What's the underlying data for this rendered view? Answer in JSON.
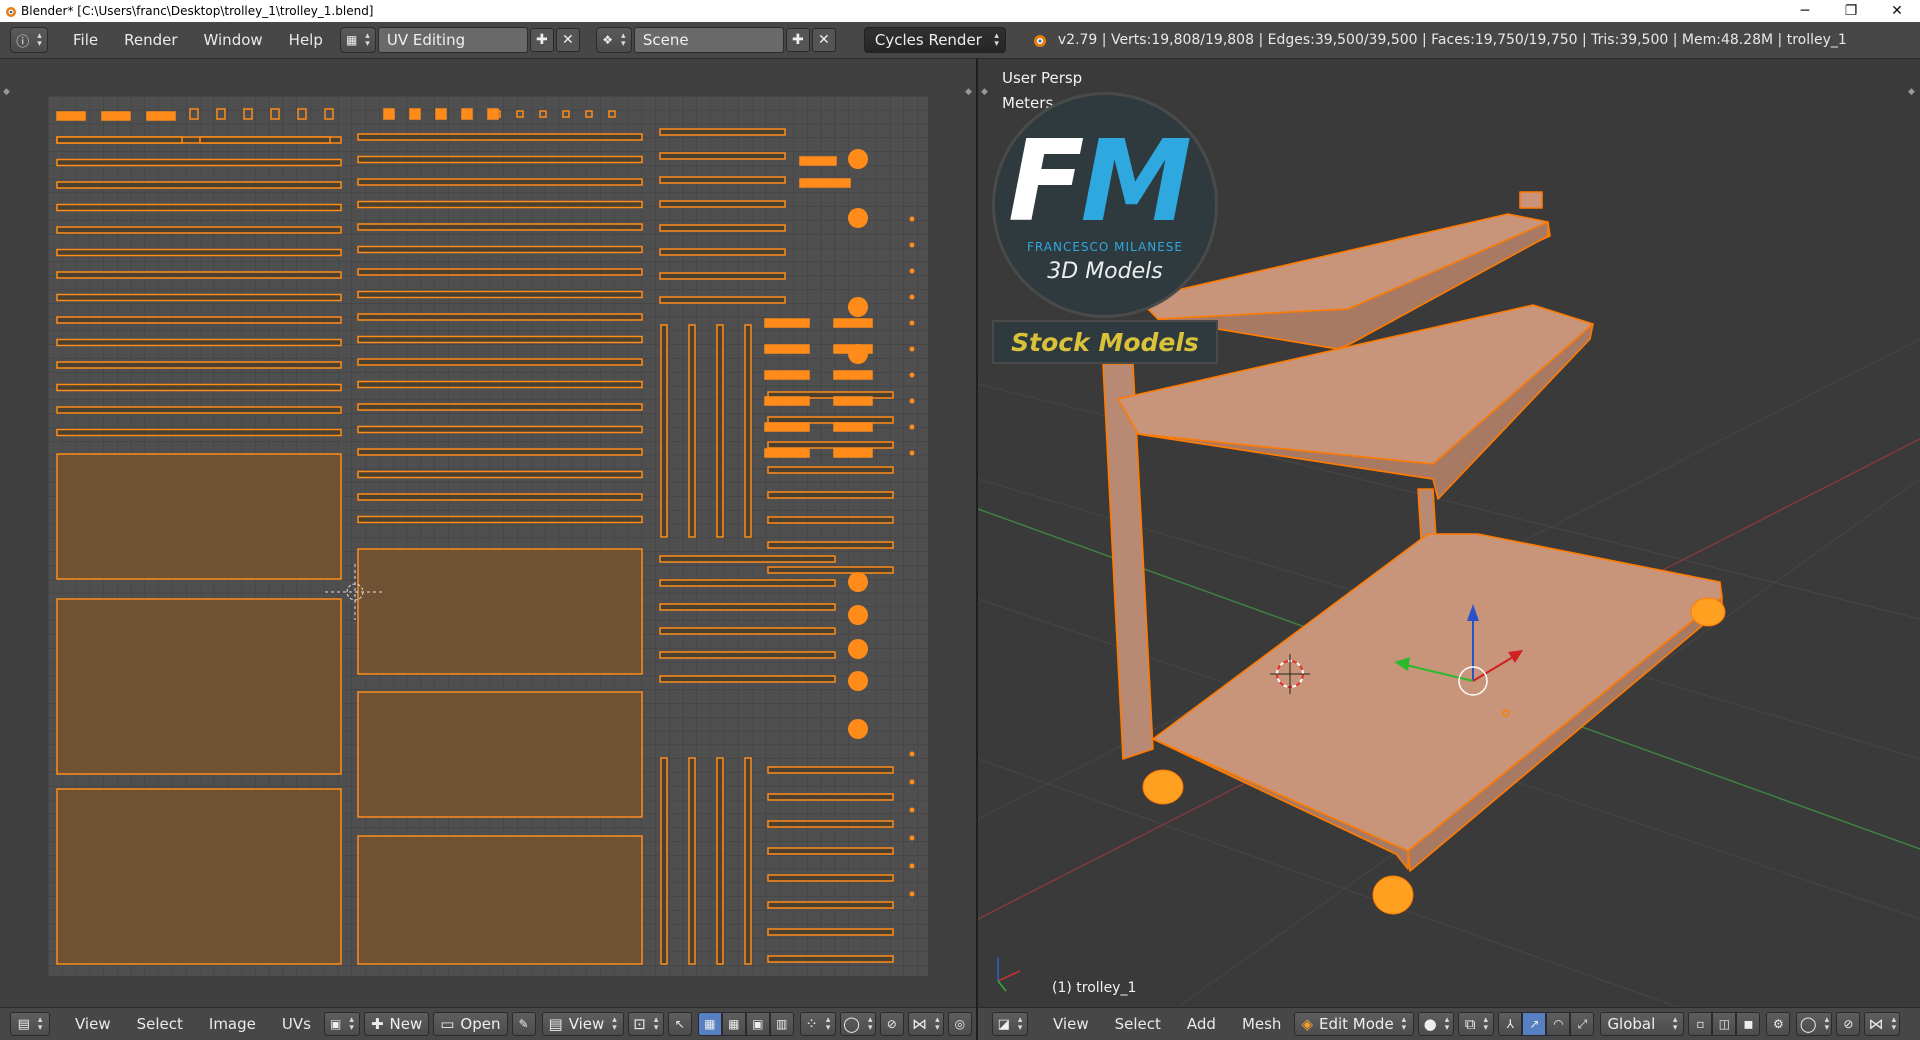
{
  "window": {
    "title": "Blender* [C:\\Users\\franc\\Desktop\\trolley_1\\trolley_1.blend]",
    "minimize": "─",
    "restore": "❐",
    "close": "✕"
  },
  "info_header": {
    "menus": [
      "File",
      "Render",
      "Window",
      "Help"
    ],
    "screen_layout": "UV Editing",
    "scene": "Scene",
    "render_engine": "Cycles Render",
    "stats": "v2.79 | Verts:19,808/19,808 | Edges:39,500/39,500 | Faces:19,750/19,750 | Tris:39,500 | Mem:48.28M | trolley_1"
  },
  "uv_editor": {
    "bottom_menus": [
      "View",
      "Select",
      "Image",
      "UVs"
    ],
    "new_label": "New",
    "open_label": "Open",
    "view_label": "View"
  },
  "viewport": {
    "view_name": "User Persp",
    "units": "Meters",
    "object_label": "(1) trolley_1",
    "bottom_menus": [
      "View",
      "Select",
      "Add",
      "Mesh"
    ],
    "mode": "Edit Mode",
    "orientation": "Global"
  },
  "logo": {
    "letters": "FM",
    "name": "FRANCESCO MILANESE",
    "subtitle": "3D Models",
    "banner": "Stock Models"
  },
  "colors": {
    "uv_orange": "#ff8c1a",
    "mesh_fill": "#c8957a",
    "accent_blue": "#5680c2",
    "logo_blue": "#2fa8df",
    "banner_text": "#d9c23a"
  }
}
